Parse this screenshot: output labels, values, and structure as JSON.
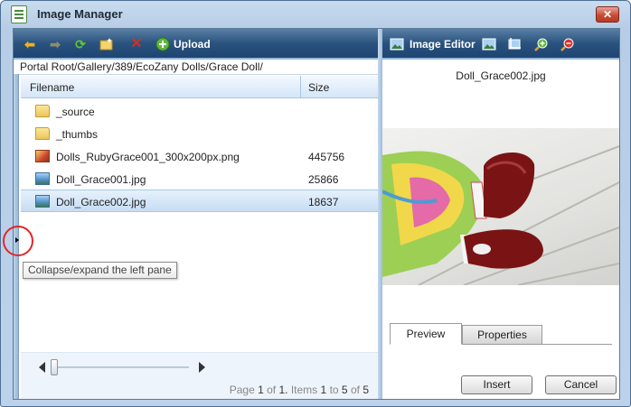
{
  "window": {
    "title": "Image Manager",
    "close_glyph": "✕"
  },
  "toolbar_left": {
    "upload_label": "Upload",
    "icons": [
      "back-arrow-icon",
      "forward-arrow-icon",
      "refresh-icon",
      "new-folder-icon",
      "delete-icon",
      "upload-icon"
    ]
  },
  "toolbar_right": {
    "image_editor_label": "Image Editor",
    "icons": [
      "image-editor-icon",
      "resize-icon",
      "crop-icon",
      "zoom-in-icon",
      "zoom-out-icon"
    ]
  },
  "path": "Portal Root/Gallery/389/EcoZany Dolls/Grace Doll/",
  "grid": {
    "columns": [
      "Filename",
      "Size"
    ],
    "rows": [
      {
        "name": "_source",
        "size": "",
        "type": "folder"
      },
      {
        "name": "_thumbs",
        "size": "",
        "type": "folder"
      },
      {
        "name": "Dolls_RubyGrace001_300x200px.png",
        "size": "445756",
        "type": "png"
      },
      {
        "name": "Doll_Grace001.jpg",
        "size": "25866",
        "type": "image"
      },
      {
        "name": "Doll_Grace002.jpg",
        "size": "18637",
        "type": "image",
        "selected": true
      }
    ]
  },
  "pager": {
    "page_word": "Page",
    "page": "1",
    "of_word": "of",
    "total_pages": "1.",
    "items_word": "Items",
    "from": "1",
    "to_word": "to",
    "to": "5",
    "of_word2": "of",
    "total_items": "5"
  },
  "tooltip": "Collapse/expand the left pane",
  "preview": {
    "filename": "Doll_Grace002.jpg",
    "tabs": [
      "Preview",
      "Properties"
    ],
    "active_tab": "Preview"
  },
  "buttons": {
    "insert": "Insert",
    "cancel": "Cancel"
  },
  "colors": {
    "toolbar": "#29527e",
    "selection": "#c7ddf4",
    "annotation_circle": "#e02828"
  }
}
